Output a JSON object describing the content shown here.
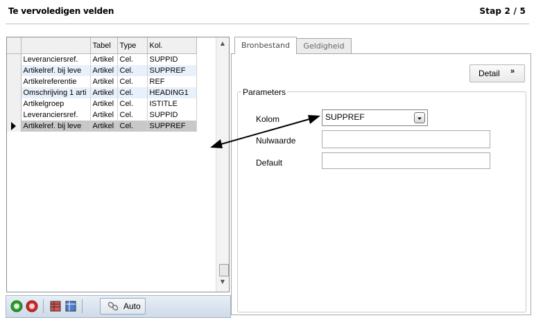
{
  "header": {
    "title": "Te vervoledigen velden",
    "step": "Stap  2 / 5"
  },
  "grid": {
    "columns": [
      "",
      "Tabel",
      "Type",
      "Kol."
    ],
    "rows": [
      {
        "name": "Leveranciersref.",
        "tabel": "Artikel",
        "type": "Cel.",
        "kol": "SUPPID"
      },
      {
        "name": "Artikelref. bij leve",
        "tabel": "Artikel",
        "type": "Cel.",
        "kol": "SUPPREF"
      },
      {
        "name": "Artikelreferentie",
        "tabel": "Artikel",
        "type": "Cel.",
        "kol": "REF"
      },
      {
        "name": "Omschrijving 1 arti",
        "tabel": "Artikel",
        "type": "Cel.",
        "kol": "HEADING1"
      },
      {
        "name": "Artikelgroep",
        "tabel": "Artikel",
        "type": "Cel.",
        "kol": "ISTITLE"
      },
      {
        "name": "Leveranciersref.",
        "tabel": "Artikel",
        "type": "Cel.",
        "kol": "SUPPID"
      },
      {
        "name": "Artikelref. bij leve",
        "tabel": "Artikel",
        "type": "Cel.",
        "kol": "SUPPREF"
      }
    ],
    "selected_row": 6
  },
  "toolbar": {
    "auto_label": "Auto",
    "icons": [
      "add-green-icon",
      "remove-red-icon",
      "table-red-icon",
      "table-blue-icon",
      "link-icon"
    ]
  },
  "tabs": [
    {
      "label": "Bronbestand",
      "active": true
    },
    {
      "label": "Geldigheid",
      "active": false
    }
  ],
  "detail_button": {
    "label": "Detail",
    "icon": "double-chevron-down-icon"
  },
  "parameters": {
    "legend": "Parameters",
    "kolom": {
      "label": "Kolom",
      "value": "SUPPREF"
    },
    "nulwaarde": {
      "label": "Nulwaarde",
      "value": ""
    },
    "default": {
      "label": "Default",
      "value": ""
    }
  },
  "colors": {
    "row_alt": "#e8f0fb",
    "row_selected": "#c8c8c8",
    "toolbar_bg": "#cfdbe8"
  }
}
